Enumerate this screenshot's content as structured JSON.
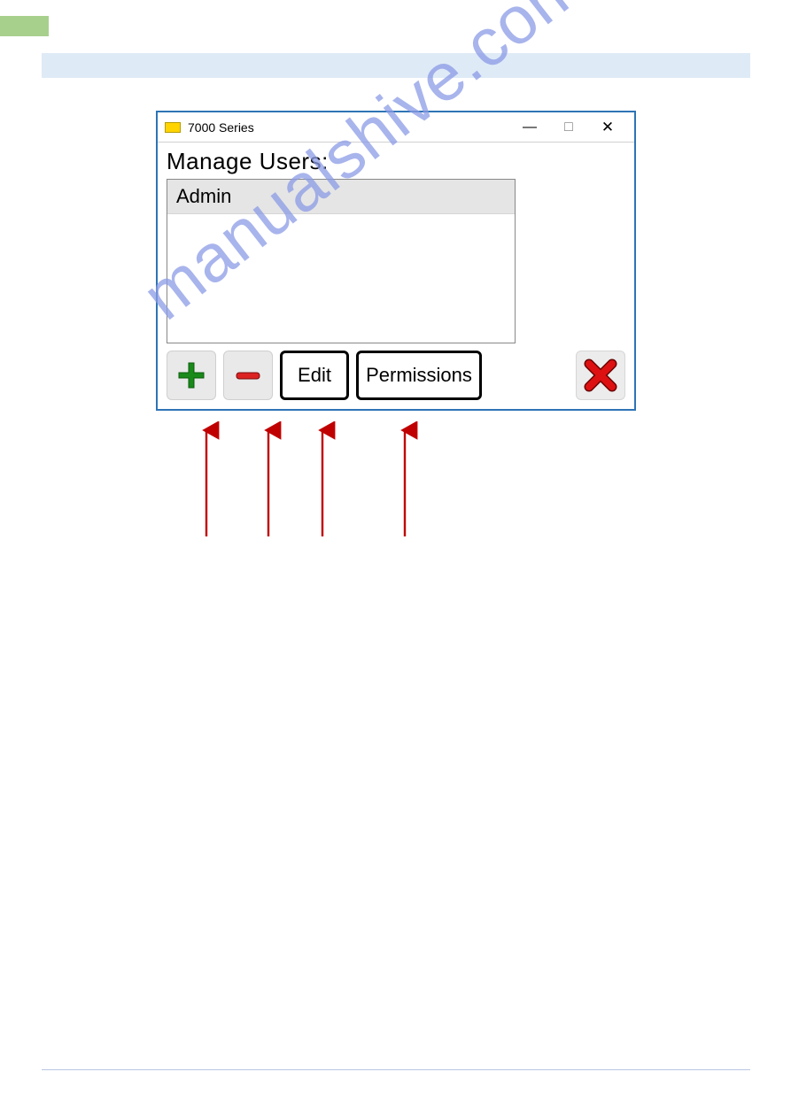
{
  "page": {
    "section_number": "",
    "watermark": "manualshive.com"
  },
  "dialog": {
    "window_title": "7000 Series",
    "heading": "Manage  Users:",
    "users": {
      "row0": "Admin"
    },
    "buttons": {
      "edit": "Edit",
      "permissions": "Permissions"
    },
    "win_controls": {
      "minimize": "—",
      "maximize": "□",
      "close": "✕"
    }
  },
  "icons": {
    "app": "app-icon",
    "plus": "plus-icon",
    "minus": "minus-icon",
    "close_red": "close-x-icon"
  }
}
